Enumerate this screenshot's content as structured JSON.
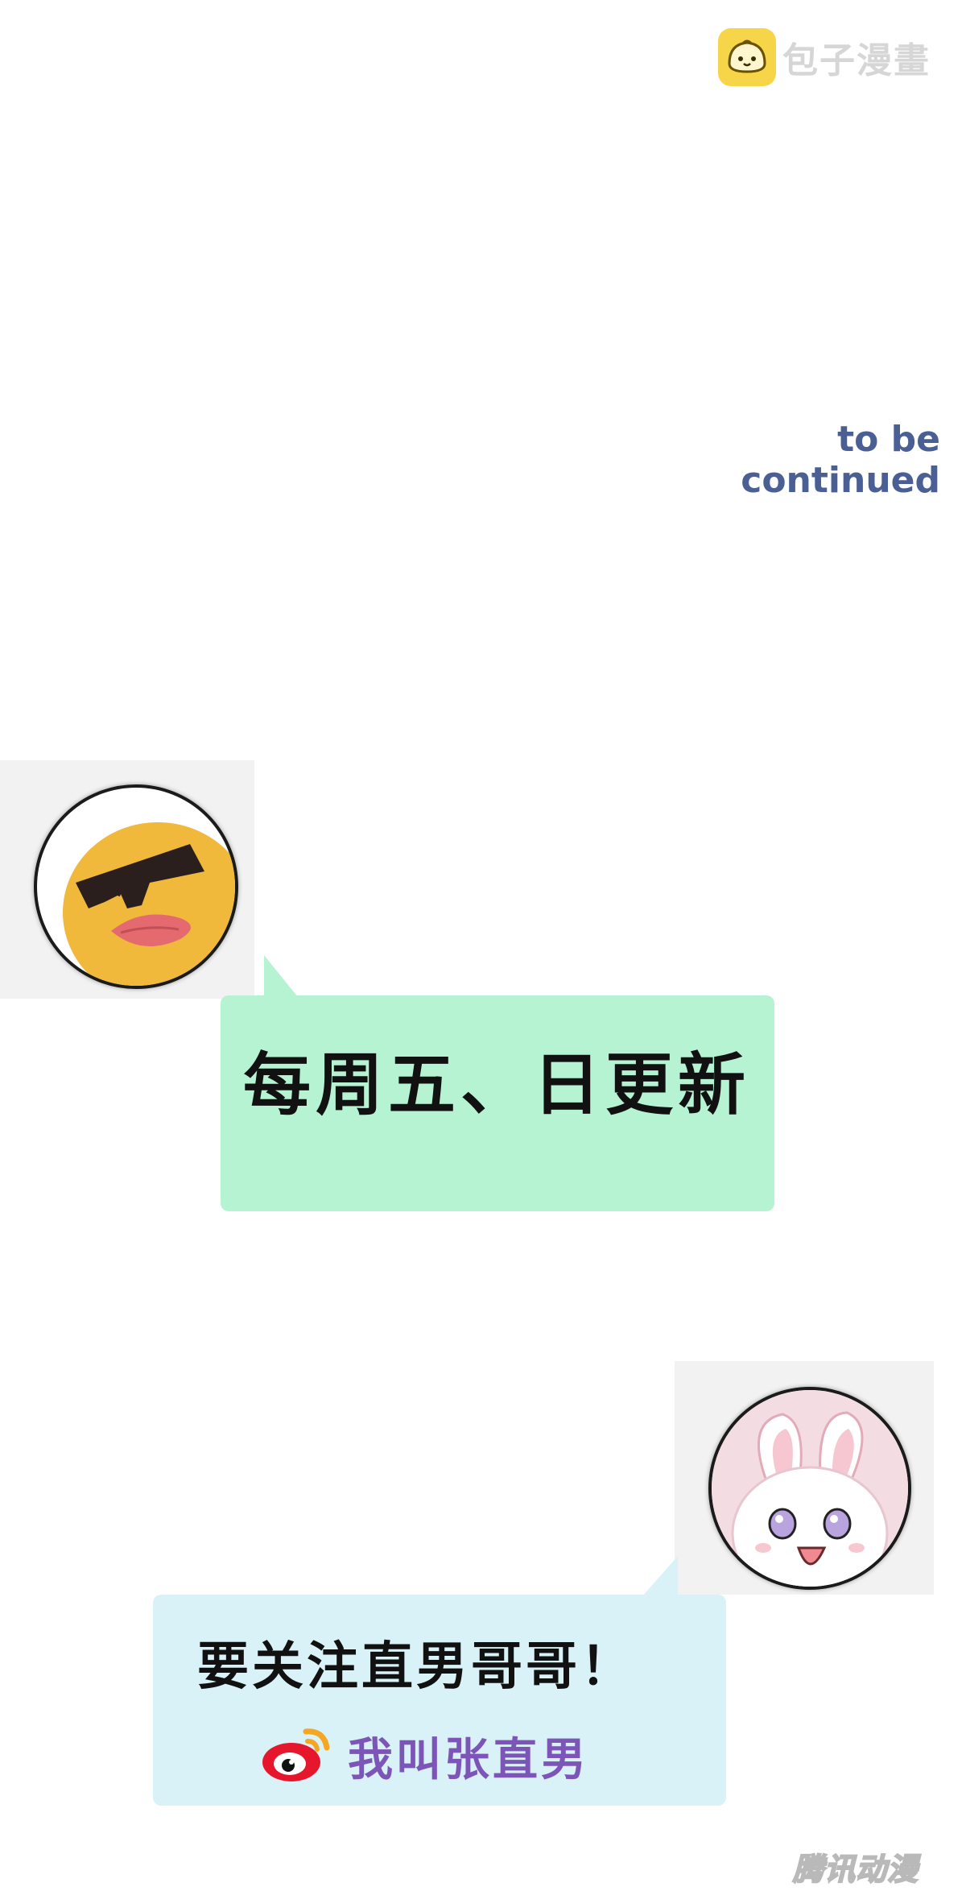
{
  "watermark_top": {
    "text": "包子漫畫",
    "icon": "bun-icon"
  },
  "tbc": "to be continued",
  "message_one": {
    "text": "每周五、日更新",
    "avatar": "sunglasses-duck-avatar"
  },
  "message_two": {
    "text": "要关注直男哥哥！",
    "weibo_icon": "weibo-icon",
    "weibo_name": "我叫张直男",
    "avatar": "bunny-avatar"
  },
  "watermark_bottom": "腾讯动漫",
  "colors": {
    "green_bubble": "#b6f3d3",
    "blue_bubble": "#d9f2f7",
    "tbc_text": "#4a5f93",
    "weibo_name": "#7d55b8",
    "bun": "#f7d548"
  }
}
